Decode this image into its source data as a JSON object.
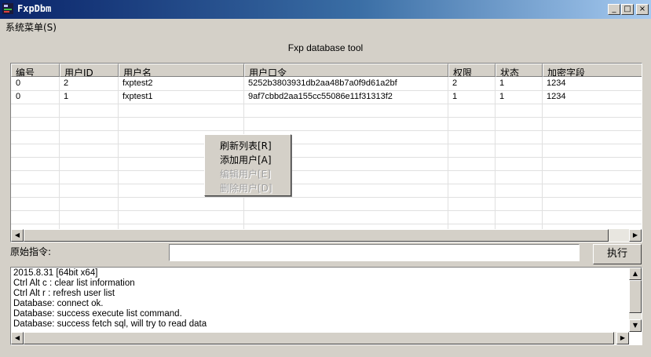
{
  "window": {
    "title": "FxpDbm",
    "minimize_glyph": "_",
    "maximize_glyph": "□",
    "close_glyph": "×"
  },
  "menu": {
    "system": "系统菜单(S)"
  },
  "heading": "Fxp database tool",
  "table": {
    "columns": [
      "编号",
      "用户ID",
      "用户名",
      "用户口令",
      "权限",
      "状态",
      "加密字段"
    ],
    "rows": [
      [
        "0",
        "2",
        "fxptest2",
        "5252b3803931db2aa48b7a0f9d61a2bf",
        "2",
        "1",
        "1234"
      ],
      [
        "0",
        "1",
        "fxptest1",
        "9af7cbbd2aa155cc55086e11f31313f2",
        "1",
        "1",
        "1234"
      ]
    ]
  },
  "context_menu": {
    "items": [
      {
        "label": "刷新列表[R]",
        "enabled": true
      },
      {
        "label": "添加用户[A]",
        "enabled": true
      },
      {
        "label": "编辑用户[E]",
        "enabled": false
      },
      {
        "label": "删除用户[D]",
        "enabled": false
      }
    ]
  },
  "command": {
    "label": "原始指令:",
    "value": "",
    "execute_label": "执行"
  },
  "log": {
    "lines": [
      "2015.8.31 [64bit x64]",
      "Ctrl Alt c : clear list information",
      "Ctrl Alt r : refresh user list",
      "Database: connect ok.",
      "Database: success execute list command.",
      "Database: success fetch sql, will try to read data"
    ]
  },
  "scroll_glyphs": {
    "left": "◀",
    "right": "▶",
    "up": "▲",
    "down": "▼"
  }
}
